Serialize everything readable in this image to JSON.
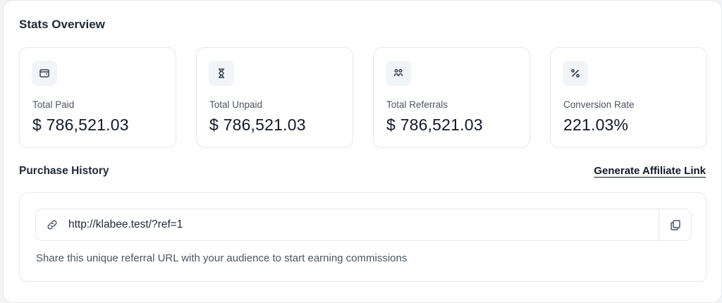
{
  "stats": {
    "title": "Stats Overview",
    "cards": [
      {
        "icon": "wallet-icon",
        "label": "Total Paid",
        "value": "$ 786,521.03"
      },
      {
        "icon": "hourglass-icon",
        "label": "Total Unpaid",
        "value": "$ 786,521.03"
      },
      {
        "icon": "users-icon",
        "label": "Total Referrals",
        "value": "$ 786,521.03"
      },
      {
        "icon": "percent-icon",
        "label": "Conversion Rate",
        "value": "221.03%"
      }
    ]
  },
  "history": {
    "title": "Purchase History",
    "affiliate_link_label": "Generate Affiliate Link"
  },
  "referral": {
    "link_icon": "link-icon",
    "url": "http://klabee.test/?ref=1",
    "copy_icon": "copy-icon",
    "helper": "Share this unique referral URL with your audience to start earning commissions"
  },
  "colors": {
    "background": "#ffffff",
    "border": "#e5e7eb",
    "icon_bg": "#f1f5f9",
    "text_primary": "#111827",
    "text_secondary": "#4b5563"
  }
}
